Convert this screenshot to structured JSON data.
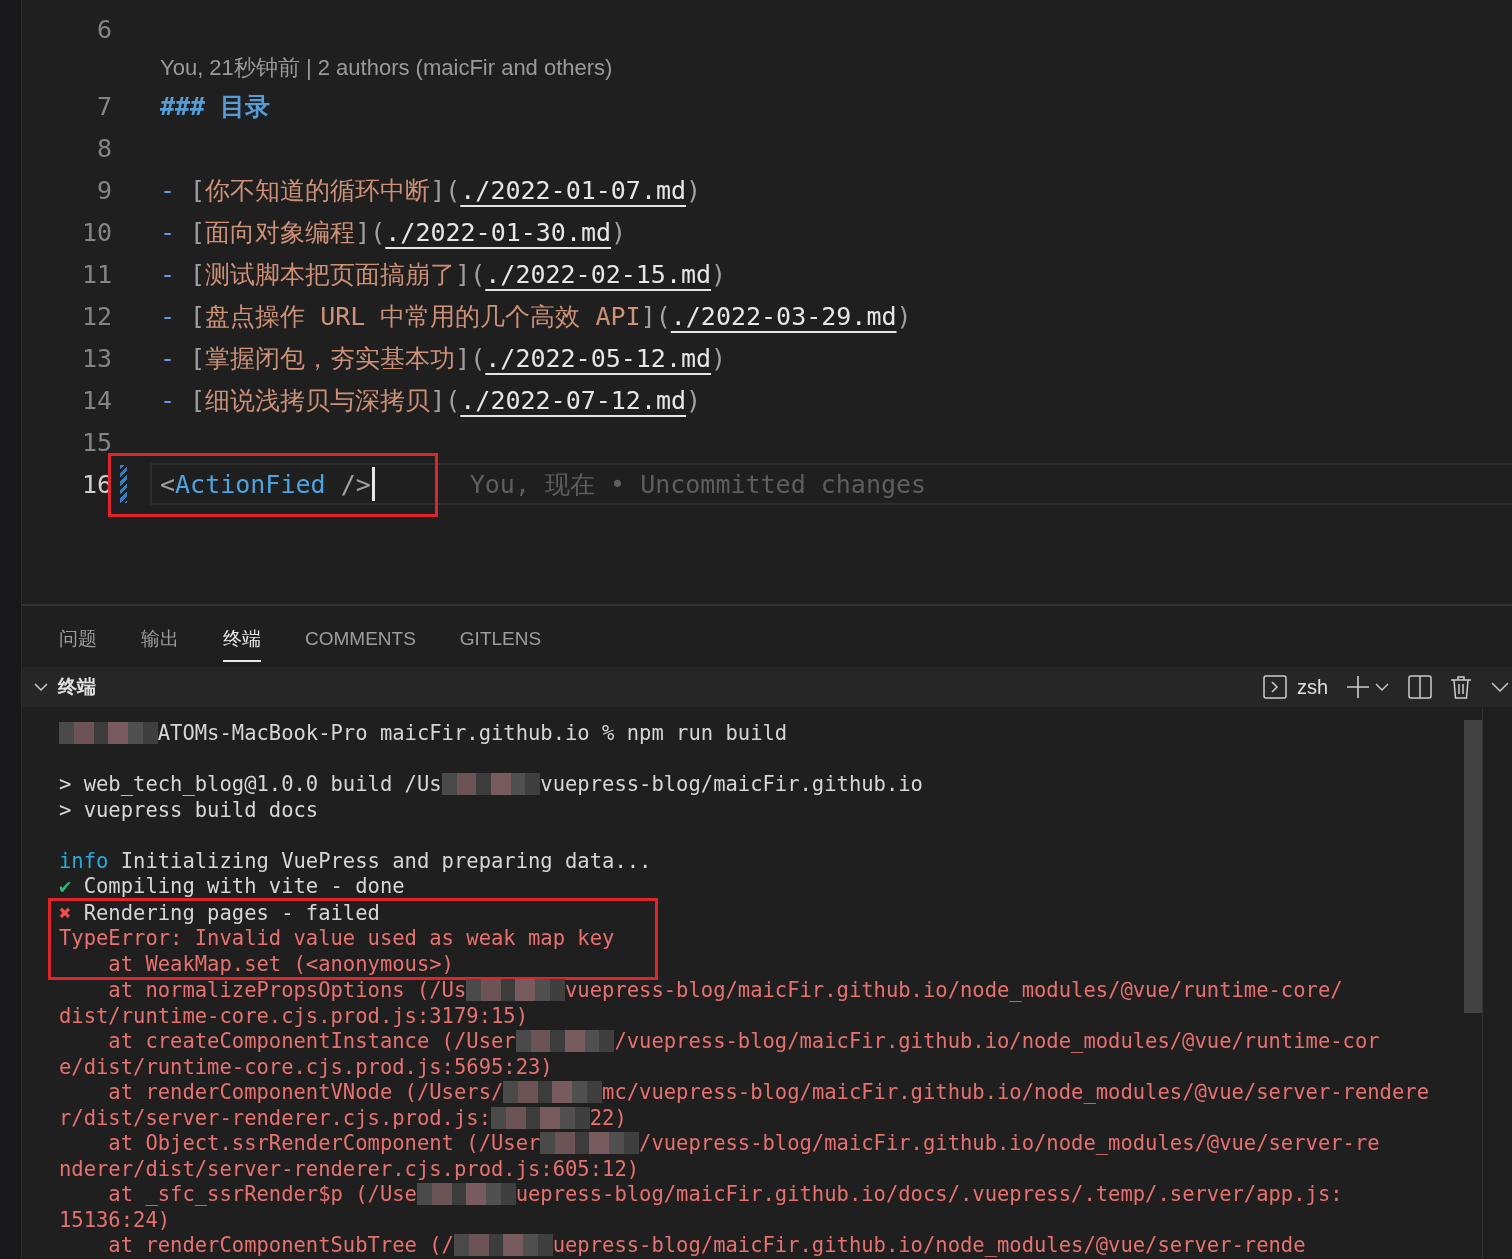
{
  "editor": {
    "lines": [
      {
        "number": "6"
      },
      {
        "number": "7",
        "codelens": "You, 21秒钟前 | 2 authors (maicFir and others)",
        "tokens": [
          {
            "t": "### 目录",
            "kind": "heading"
          }
        ]
      },
      {
        "number": "8"
      },
      {
        "number": "9",
        "tokens": [
          {
            "t": "-",
            "kind": "marker"
          },
          {
            "t": " [",
            "kind": "punct"
          },
          {
            "t": "你不知道的循环中断",
            "kind": "link-text"
          },
          {
            "t": "](",
            "kind": "punct"
          },
          {
            "t": "./2022-01-07.md",
            "kind": "url"
          },
          {
            "t": ")",
            "kind": "punct"
          }
        ]
      },
      {
        "number": "10",
        "tokens": [
          {
            "t": "-",
            "kind": "marker"
          },
          {
            "t": " [",
            "kind": "punct"
          },
          {
            "t": "面向对象编程",
            "kind": "link-text"
          },
          {
            "t": "](",
            "kind": "punct"
          },
          {
            "t": "./2022-01-30.md",
            "kind": "url"
          },
          {
            "t": ")",
            "kind": "punct"
          }
        ]
      },
      {
        "number": "11",
        "tokens": [
          {
            "t": "-",
            "kind": "marker"
          },
          {
            "t": " [",
            "kind": "punct"
          },
          {
            "t": "测试脚本把页面搞崩了",
            "kind": "link-text"
          },
          {
            "t": "](",
            "kind": "punct"
          },
          {
            "t": "./2022-02-15.md",
            "kind": "url"
          },
          {
            "t": ")",
            "kind": "punct"
          }
        ]
      },
      {
        "number": "12",
        "tokens": [
          {
            "t": "-",
            "kind": "marker"
          },
          {
            "t": " [",
            "kind": "punct"
          },
          {
            "t": "盘点操作 URL 中常用的几个高效 API",
            "kind": "link-text"
          },
          {
            "t": "](",
            "kind": "punct"
          },
          {
            "t": "./2022-03-29.md",
            "kind": "url"
          },
          {
            "t": ")",
            "kind": "punct"
          }
        ]
      },
      {
        "number": "13",
        "tokens": [
          {
            "t": "-",
            "kind": "marker"
          },
          {
            "t": " [",
            "kind": "punct"
          },
          {
            "t": "掌握闭包，夯实基本功",
            "kind": "link-text"
          },
          {
            "t": "](",
            "kind": "punct"
          },
          {
            "t": "./2022-05-12.md",
            "kind": "url"
          },
          {
            "t": ")",
            "kind": "punct"
          }
        ]
      },
      {
        "number": "14",
        "tokens": [
          {
            "t": "-",
            "kind": "marker"
          },
          {
            "t": " [",
            "kind": "punct"
          },
          {
            "t": "细说浅拷贝与深拷贝",
            "kind": "link-text"
          },
          {
            "t": "](",
            "kind": "punct"
          },
          {
            "t": "./2022-07-12.md",
            "kind": "url"
          },
          {
            "t": ")",
            "kind": "punct"
          }
        ]
      },
      {
        "number": "15"
      },
      {
        "number": "16",
        "current": true,
        "git_change": true,
        "annotated": true,
        "blame": "You, 现在 • Uncommitted changes",
        "tokens": [
          {
            "t": "<",
            "kind": "punct"
          },
          {
            "t": "ActionFied",
            "kind": "tag"
          },
          {
            "t": " />",
            "kind": "punct"
          }
        ]
      }
    ]
  },
  "panel": {
    "tabs": [
      {
        "label": "问题",
        "selected": false
      },
      {
        "label": "输出",
        "selected": false
      },
      {
        "label": "终端",
        "selected": true
      },
      {
        "label": "COMMENTS",
        "selected": false
      },
      {
        "label": "GITLENS",
        "selected": false
      }
    ],
    "terminal": {
      "title": "终端",
      "shell": "zsh",
      "lines": [
        {
          "segments": [
            {
              "kind": "redacted"
            },
            {
              "t": "ATOMs-MacBook-Pro maicFir.github.io % npm run build",
              "kind": "plain"
            }
          ]
        },
        {
          "kind": "blank"
        },
        {
          "segments": [
            {
              "t": "> web_tech_blog@1.0.0 build /Us",
              "kind": "plain"
            },
            {
              "kind": "redacted"
            },
            {
              "t": "vuepress-blog/maicFir.github.io",
              "kind": "plain"
            }
          ]
        },
        {
          "segments": [
            {
              "t": "> vuepress build docs",
              "kind": "plain"
            }
          ]
        },
        {
          "kind": "blank"
        },
        {
          "segments": [
            {
              "t": "info",
              "kind": "info"
            },
            {
              "t": " Initializing VuePress and preparing data...",
              "kind": "plain"
            }
          ]
        },
        {
          "segments": [
            {
              "t": "✔",
              "kind": "ok"
            },
            {
              "t": " Compiling with vite - done",
              "kind": "plain"
            }
          ]
        },
        {
          "annotated": true,
          "segments": [
            {
              "t": "✖",
              "kind": "fail"
            },
            {
              "t": " Rendering pages - failed",
              "kind": "plain"
            }
          ]
        },
        {
          "annotated": true,
          "segments": [
            {
              "t": "TypeError: Invalid value used as weak map key",
              "kind": "error"
            }
          ]
        },
        {
          "annotated": true,
          "segments": [
            {
              "t": "    at WeakMap.set (<anonymous>)",
              "kind": "error"
            }
          ]
        },
        {
          "segments": [
            {
              "t": "    at normalizePropsOptions (/Us",
              "kind": "error"
            },
            {
              "kind": "redacted"
            },
            {
              "t": "vuepress-blog/maicFir.github.io/node_modules/@vue/runtime-core/",
              "kind": "error"
            }
          ]
        },
        {
          "segments": [
            {
              "t": "dist/runtime-core.cjs.prod.js:3179:15)",
              "kind": "error"
            }
          ]
        },
        {
          "segments": [
            {
              "t": "    at createComponentInstance (/User",
              "kind": "error"
            },
            {
              "kind": "redacted"
            },
            {
              "t": "/vuepress-blog/maicFir.github.io/node_modules/@vue/runtime-cor",
              "kind": "error"
            }
          ]
        },
        {
          "segments": [
            {
              "t": "e/dist/runtime-core.cjs.prod.js:5695:23)",
              "kind": "error"
            }
          ]
        },
        {
          "segments": [
            {
              "t": "    at renderComponentVNode (/Users/",
              "kind": "error"
            },
            {
              "kind": "redacted"
            },
            {
              "t": "mc/vuepress-blog/maicFir.github.io/node_modules/@vue/server-rendere",
              "kind": "error"
            }
          ]
        },
        {
          "segments": [
            {
              "t": "r/dist/server-renderer.cjs.prod.js:",
              "kind": "error"
            },
            {
              "kind": "redacted"
            },
            {
              "t": "22)",
              "kind": "error"
            }
          ]
        },
        {
          "segments": [
            {
              "t": "    at Object.ssrRenderComponent (/User",
              "kind": "error"
            },
            {
              "kind": "redacted"
            },
            {
              "t": "/vuepress-blog/maicFir.github.io/node_modules/@vue/server-re",
              "kind": "error"
            }
          ]
        },
        {
          "segments": [
            {
              "t": "nderer/dist/server-renderer.cjs.prod.js:605:12)",
              "kind": "error"
            }
          ]
        },
        {
          "segments": [
            {
              "t": "    at _sfc_ssrRender$p (/Use",
              "kind": "error"
            },
            {
              "kind": "redacted"
            },
            {
              "t": "uepress-blog/maicFir.github.io/docs/.vuepress/.temp/.server/app.js:",
              "kind": "error"
            }
          ]
        },
        {
          "segments": [
            {
              "t": "15136:24)",
              "kind": "error"
            }
          ]
        },
        {
          "segments": [
            {
              "t": "    at renderComponentSubTree (/",
              "kind": "error"
            },
            {
              "kind": "redacted"
            },
            {
              "t": "uepress-blog/maicFir.github.io/node_modules/@vue/server-rende",
              "kind": "error"
            }
          ]
        }
      ]
    }
  }
}
